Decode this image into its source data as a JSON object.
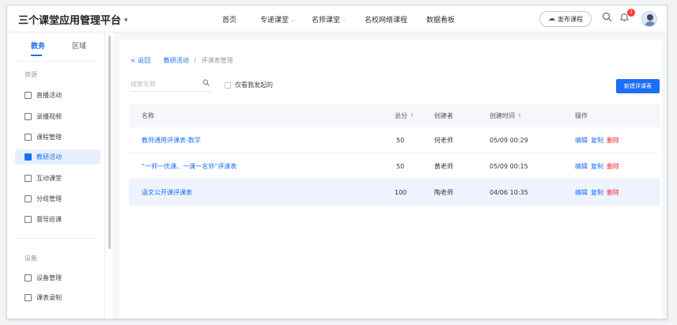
{
  "header": {
    "app_title": "三个课堂应用管理平台",
    "nav": [
      {
        "label": "首页",
        "has_dropdown": false
      },
      {
        "label": "专递课堂",
        "has_dropdown": true
      },
      {
        "label": "名师课堂",
        "has_dropdown": true
      },
      {
        "label": "名校网络课程",
        "has_dropdown": false
      },
      {
        "label": "数据看板",
        "has_dropdown": false
      }
    ],
    "publish_label": "发布课程",
    "notification_count": "1"
  },
  "sidebar": {
    "tabs": [
      {
        "label": "教务",
        "active": true
      },
      {
        "label": "区域",
        "active": false
      }
    ],
    "sections": [
      {
        "label": "资源",
        "items": [
          {
            "label": "直播活动",
            "icon": "live-icon",
            "active": false
          },
          {
            "label": "录播视频",
            "icon": "video-icon",
            "active": false
          },
          {
            "label": "课程管理",
            "icon": "course-icon",
            "active": false
          },
          {
            "label": "教研活动",
            "icon": "research-icon",
            "active": true
          },
          {
            "label": "互动课堂",
            "icon": "interactive-icon",
            "active": false
          },
          {
            "label": "分组管理",
            "icon": "group-icon",
            "active": false
          },
          {
            "label": "督导巡课",
            "icon": "supervise-icon",
            "active": false
          }
        ]
      },
      {
        "label": "设备",
        "items": [
          {
            "label": "设备管理",
            "icon": "device-icon",
            "active": false
          },
          {
            "label": "课表录制",
            "icon": "schedule-icon",
            "active": false
          }
        ]
      }
    ]
  },
  "main": {
    "breadcrumb": {
      "back": "< 返回",
      "parent": "教研活动",
      "separator": "/",
      "current": "评课表管理"
    },
    "search_placeholder": "搜索名称",
    "checkbox_label": "仅看我发起的",
    "checkbox_checked": false,
    "new_button": "新建评课表",
    "table": {
      "columns": [
        "名称",
        "总分",
        "创建者",
        "创建时间",
        "操作"
      ],
      "sortable": [
        false,
        true,
        false,
        true,
        false
      ],
      "rows": [
        {
          "name": "教师通用评课表-数学",
          "score": "50",
          "creator": "何老师",
          "time": "05/09 00:29",
          "actions": [
            "编辑",
            "复制",
            "删除"
          ]
        },
        {
          "name": "“一师一优课、一课一名师”评课表",
          "score": "50",
          "creator": "黄老师",
          "time": "05/09 00:15",
          "actions": [
            "编辑",
            "复制",
            "删除"
          ]
        },
        {
          "name": "语文公开课评课表",
          "score": "100",
          "creator": "陶老师",
          "time": "04/06 10:35",
          "actions": [
            "编辑",
            "复制",
            "删除"
          ]
        }
      ]
    }
  },
  "colors": {
    "accent": "#1a6ff5",
    "danger": "#f5222d",
    "active_bg": "#e7efff"
  }
}
